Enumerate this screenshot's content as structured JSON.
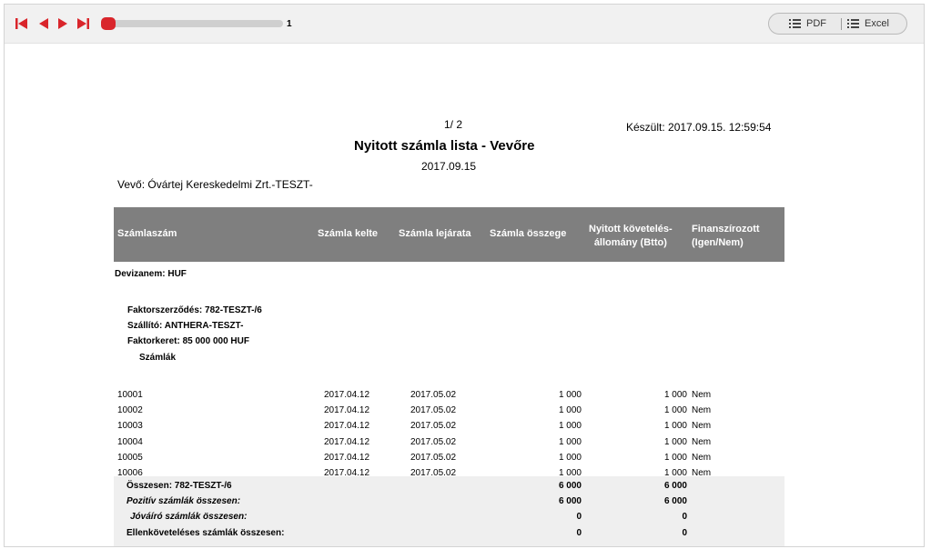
{
  "toolbar": {
    "current_page": "1",
    "progress": 0,
    "export_pdf_label": "PDF",
    "export_excel_label": "Excel",
    "accent_color": "#d9252b",
    "icons": [
      "first-page-icon",
      "previous-page-icon",
      "next-page-icon",
      "last-page-icon",
      "list-icon"
    ]
  },
  "report": {
    "page_indicator": "1/ 2",
    "created": "Készült: 2017.09.15. 12:59:54",
    "title": "Nyitott számla lista - Vevőre",
    "date": "2017.09.15",
    "buyer": "Vevő: Óvártej Kereskedelmi Zrt.-TESZT-",
    "header": {
      "szamlaszam": "Számlaszám",
      "kelte": "Számla kelte",
      "lejarata": "Számla lejárata",
      "osszege": "Számla összege",
      "nyitott_line1": "Nyitott követelés-",
      "nyitott_line2": "állomány (Btto)",
      "finanszirozott_line1": "Finanszírozott",
      "finanszirozott_line2": "(Igen/Nem)"
    },
    "currency": "Devizanem: HUF",
    "contract": "Faktorszerződés: 782-TESZT-/6",
    "supplier": "Szállító: ANTHERA-TESZT-",
    "factor_limit": "Faktorkeret: 85 000 000 HUF",
    "invoices_label": "Számlák",
    "rows": [
      {
        "id": "10001",
        "kelte": "2017.04.12",
        "lejarata": "2017.05.02",
        "osszeg": "1 000",
        "nyitott": "1 000",
        "fin": "Nem"
      },
      {
        "id": "10002",
        "kelte": "2017.04.12",
        "lejarata": "2017.05.02",
        "osszeg": "1 000",
        "nyitott": "1 000",
        "fin": "Nem"
      },
      {
        "id": "10003",
        "kelte": "2017.04.12",
        "lejarata": "2017.05.02",
        "osszeg": "1 000",
        "nyitott": "1 000",
        "fin": "Nem"
      },
      {
        "id": "10004",
        "kelte": "2017.04.12",
        "lejarata": "2017.05.02",
        "osszeg": "1 000",
        "nyitott": "1 000",
        "fin": "Nem"
      },
      {
        "id": "10005",
        "kelte": "2017.04.12",
        "lejarata": "2017.05.02",
        "osszeg": "1 000",
        "nyitott": "1 000",
        "fin": "Nem"
      },
      {
        "id": "10006",
        "kelte": "2017.04.12",
        "lejarata": "2017.05.02",
        "osszeg": "1 000",
        "nyitott": "1 000",
        "fin": "Nem"
      }
    ],
    "totals": [
      {
        "label": "Összesen: 782-TESZT-/6",
        "osszeg": "6 000",
        "nyitott": "6 000"
      },
      {
        "label": "Pozitív számlák összesen:",
        "osszeg": "6 000",
        "nyitott": "6 000"
      },
      {
        "label": "Jóváíró számlák összesen:",
        "osszeg": "0",
        "nyitott": "0"
      },
      {
        "label": "Ellenköveteléses számlák összesen:",
        "osszeg": "0",
        "nyitott": "0"
      }
    ]
  }
}
